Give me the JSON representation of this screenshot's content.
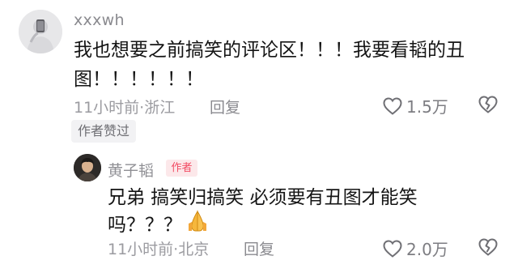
{
  "comment": {
    "username": "xxxwh",
    "text_line1": "我也想要之前搞笑的评论区！！！我要看韬的丑",
    "text_line2": "图！！！！！！",
    "time_location": "11小时前·浙江",
    "reply_label": "回复",
    "like_count": "1.5万",
    "author_liked_badge": "作者赞过"
  },
  "reply": {
    "username": "黄子韬",
    "author_tag": "作者",
    "text_line1": "兄弟 搞笑归搞笑 必须要有丑图才能笑",
    "text_line2": "吗？？？",
    "emoji": "pray-hands-icon",
    "time_location": "11小时前·北京",
    "reply_label": "回复",
    "like_count": "2.0万"
  },
  "icons": {
    "like": "heart-outline-icon",
    "dislike": "broken-heart-outline-icon"
  },
  "colors": {
    "author_tag_text": "#f24b63",
    "author_tag_bg": "#fce8ea",
    "meta_text": "#9b9ba0",
    "body_text": "#141414"
  }
}
